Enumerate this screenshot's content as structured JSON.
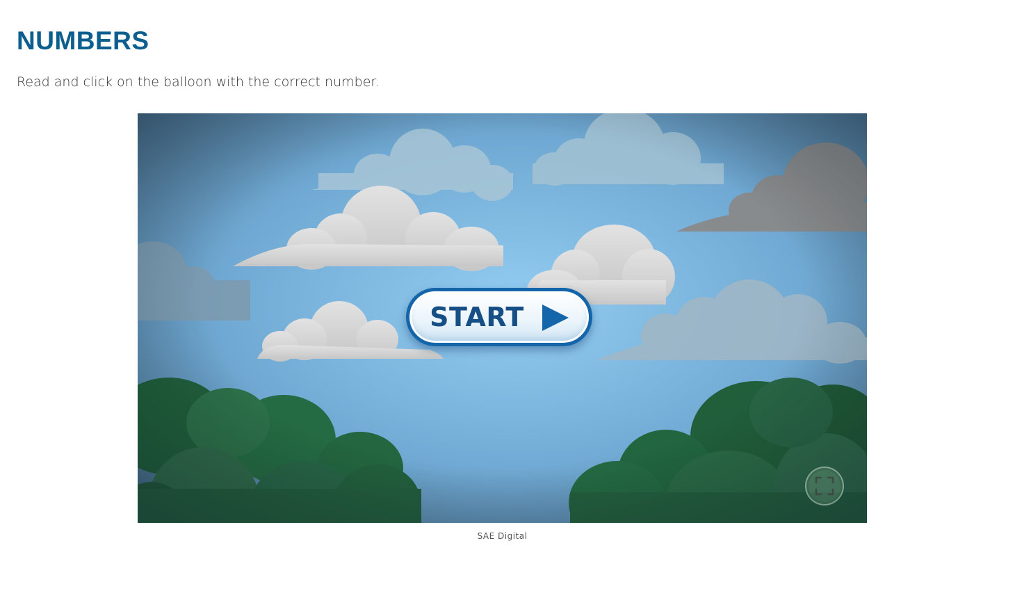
{
  "page": {
    "title": "NUMBERS",
    "instructions": "Read and click on the balloon with the correct number."
  },
  "game": {
    "start_label": "START",
    "play_icon": "play-triangle-icon",
    "fullscreen_icon": "fullscreen-icon",
    "caption": "SAE Digital"
  },
  "colors": {
    "title": "#0b5e8e",
    "button_border": "#1465aa",
    "button_text": "#164f86",
    "sky": "#8fc6ea",
    "foliage": "#236b40"
  }
}
